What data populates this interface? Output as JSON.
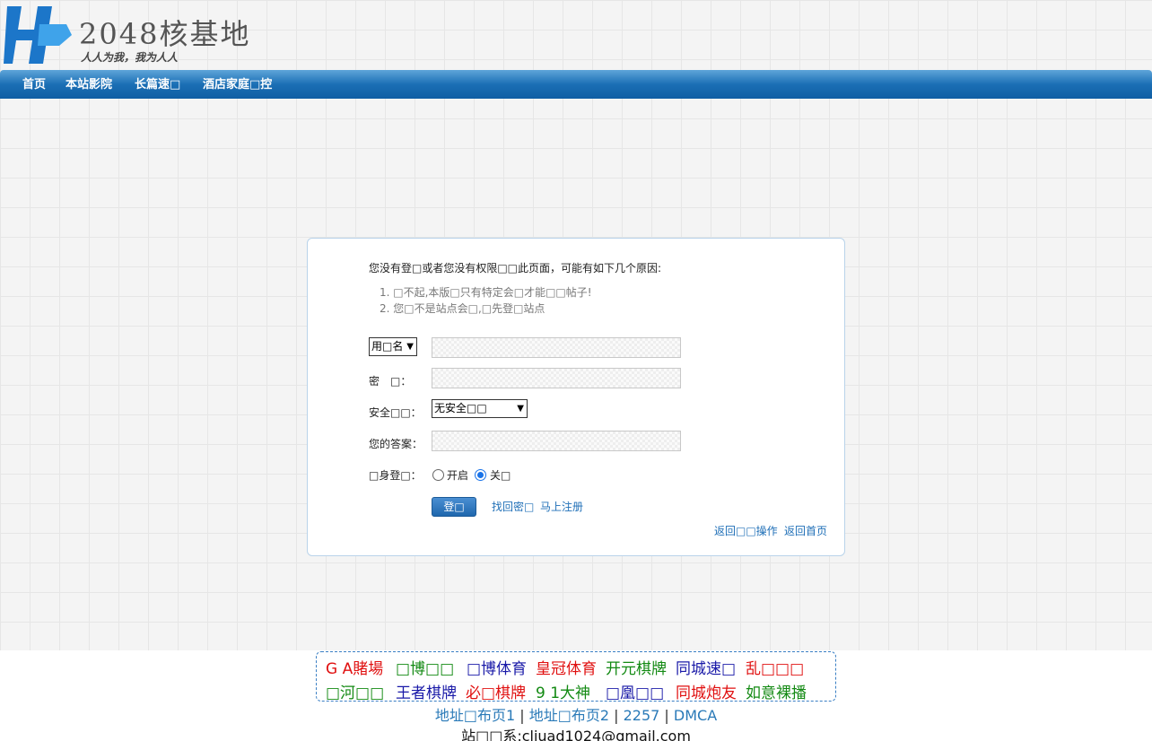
{
  "header": {
    "logo_letter": "H",
    "logo_title": "2048核基地",
    "logo_slogan": "人人为我，我为人人"
  },
  "nav": [
    {
      "label": "首页"
    },
    {
      "label": "本站影院"
    },
    {
      "label": "长篇速□"
    },
    {
      "label": "酒店家庭□控"
    }
  ],
  "login_box": {
    "message": "您没有登□或者您没有权限□□此页面，可能有如下几个原因:",
    "reasons": [
      "1. □不起,本版□只有特定会□才能□□帖子!",
      "2. 您□不是站点会□,□先登□站点"
    ],
    "username_type_select": "用□名",
    "password_label": "密　□：",
    "security_label": "安全□□：",
    "security_select": "无安全□□",
    "answer_label": "您的答案：",
    "hidden_login_label": "□身登□：",
    "radio_on_label": "开启",
    "radio_off_label": "关□",
    "hidden_login_value": "off",
    "login_button": "登□",
    "find_password": "找回密□",
    "register": "马上注册",
    "go_back": "返回□□操作",
    "go_home": "返回首页"
  },
  "ads": {
    "row1": [
      {
        "text": "G A賭場",
        "color": "#e01010"
      },
      {
        "text": "□博□□",
        "color": "#138a13"
      },
      {
        "text": "□博体育",
        "color": "#1a1aa8"
      },
      {
        "text": "皇冠体育",
        "color": "#e01010"
      },
      {
        "text": "开元棋牌",
        "color": "#138a13"
      },
      {
        "text": "同城速□",
        "color": "#1a1aa8"
      },
      {
        "text": "乱□□□",
        "color": "#e01010"
      }
    ],
    "row2": [
      {
        "text": "□河□□",
        "color": "#138a13"
      },
      {
        "text": "王者棋牌",
        "color": "#1a1aa8"
      },
      {
        "text": "必□棋牌",
        "color": "#e01010"
      },
      {
        "text": "9 1大神",
        "color": "#138a13"
      },
      {
        "text": "□凰□□",
        "color": "#1a1aa8"
      },
      {
        "text": "同城炮友",
        "color": "#e01010"
      },
      {
        "text": "如意裸播",
        "color": "#138a13"
      }
    ]
  },
  "footer": {
    "links": [
      "地址□布页1",
      "地址□布页2",
      "2257",
      "DMCA"
    ],
    "separator": "|",
    "contact": "站□□系:cliuad1024@gmail.com"
  },
  "colors": {
    "nav_blue": "#1b6fb5",
    "logo_blue": "#1c76c9",
    "link_blue": "#1f6fb7"
  }
}
